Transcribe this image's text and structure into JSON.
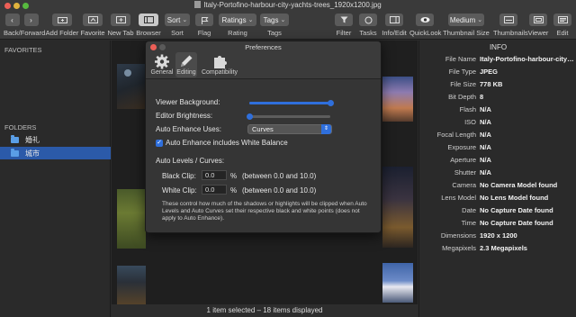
{
  "window": {
    "title": "Italy-Portofino-harbour-city-yachts-trees_1920x1200.jpg",
    "traffic_colors": [
      "#ec5f57",
      "#e0b33d",
      "#57b93f"
    ]
  },
  "toolbar": {
    "back_forward": "Back/Forward",
    "add_folder": "Add Folder",
    "favorite": "Favorite",
    "new_tab": "New Tab",
    "browser": "Browser",
    "sort_button": "Sort",
    "sort_label": "Sort",
    "flag": "Flag",
    "ratings_button": "Ratings",
    "rating_label": "Rating",
    "tags_button": "Tags",
    "tags_label": "Tags",
    "filter": "Filter",
    "tasks": "Tasks",
    "info_edit": "Info/Edit",
    "quicklook": "QuickLook",
    "thumbnail_size_value": "Medium",
    "thumbnail_size_label": "Thumbnail Size",
    "thumbnails": "Thumbnails",
    "viewer": "Viewer",
    "edit": "Edit"
  },
  "sidebar": {
    "favorites_header": "FAVORITES",
    "folders_header": "FOLDERS",
    "folders": [
      {
        "label": "婚礼",
        "selected": false
      },
      {
        "label": "城市",
        "selected": true
      }
    ]
  },
  "status_bar": "1 item selected – 18 items displayed",
  "info_panel": {
    "title": "INFO",
    "rows": [
      {
        "key": "File Name",
        "value": "Italy-Portofino-harbour-city-ya..."
      },
      {
        "key": "File Type",
        "value": "JPEG"
      },
      {
        "key": "File Size",
        "value": "778 KB"
      },
      {
        "key": "Bit Depth",
        "value": "8"
      },
      {
        "key": "Flash",
        "value": "N/A"
      },
      {
        "key": "ISO",
        "value": "N/A"
      },
      {
        "key": "Focal Length",
        "value": "N/A"
      },
      {
        "key": "Exposure",
        "value": "N/A"
      },
      {
        "key": "Aperture",
        "value": "N/A"
      },
      {
        "key": "Shutter",
        "value": "N/A"
      },
      {
        "key": "Camera",
        "value": "No Camera Model found"
      },
      {
        "key": "Lens Model",
        "value": "No Lens Model found"
      },
      {
        "key": "Date",
        "value": "No Capture Date found"
      },
      {
        "key": "Time",
        "value": "No Capture Date found"
      },
      {
        "key": "Dimensions",
        "value": "1920 x 1200"
      },
      {
        "key": "Megapixels",
        "value": "2.3 Megapixels"
      }
    ]
  },
  "preferences": {
    "title": "Preferences",
    "tabs": [
      "General",
      "Editing",
      "Compatibility"
    ],
    "selected_tab": "Editing",
    "viewer_background_label": "Viewer Background:",
    "viewer_background_level": 1.0,
    "editor_brightness_label": "Editor Brightness:",
    "editor_brightness_level": 0.0,
    "auto_enhance_label": "Auto Enhance Uses:",
    "auto_enhance_value": "Curves",
    "white_balance_label": "Auto Enhance includes White Balance",
    "white_balance_checked": true,
    "levels_header": "Auto Levels / Curves:",
    "black_clip_label": "Black Clip:",
    "black_clip_value": "0.0",
    "black_clip_range": "(between 0.0 and 10.0)",
    "white_clip_label": "White Clip:",
    "white_clip_value": "0.0",
    "white_clip_range": "(between 0.0 and 10.0)",
    "percent": "%",
    "note": "These control how much of the shadows or highlights will be clipped when Auto Levels and Auto Curves set their respective black and white points (does not apply to Auto Enhance).",
    "accent": "#2f6fdc"
  }
}
